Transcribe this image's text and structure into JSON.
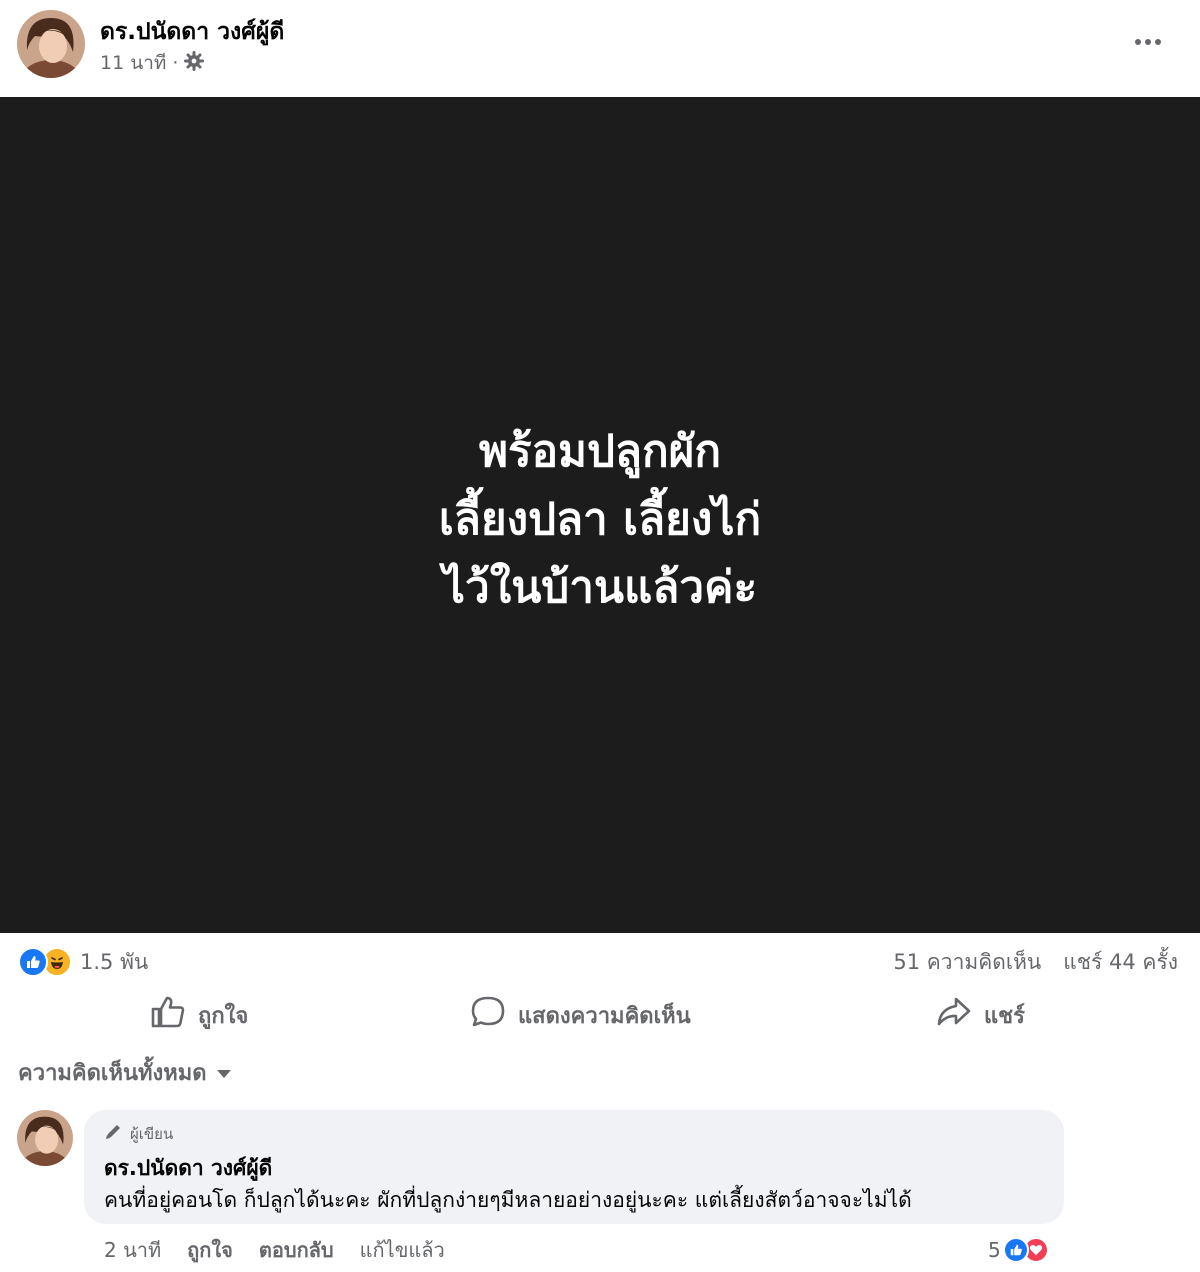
{
  "post": {
    "author": "ดร.ปนัดดา วงศ์ผู้ดี",
    "time": "11 นาที",
    "separator": "·",
    "privacy_icon": "gear-icon",
    "media_text": [
      "พร้อมปลูกผัก",
      "เลี้ยงปลา เลี้ยงไก่",
      "ไว้ในบ้านแล้วค่ะ"
    ]
  },
  "stats": {
    "reactions_count": "1.5 พัน",
    "reaction_icons": [
      "like-icon",
      "haha-icon"
    ],
    "comments": "51 ความคิดเห็น",
    "shares": "แชร์ 44 ครั้ง"
  },
  "actions": {
    "like": "ถูกใจ",
    "comment": "แสดงความคิดเห็น",
    "share": "แชร์"
  },
  "comments_section": {
    "filter": "ความคิดเห็นทั้งหมด"
  },
  "comment": {
    "badge": "ผู้เขียน",
    "author": "ดร.ปนัดดา วงศ์ผู้ดี",
    "text": "คนที่อยู่คอนโด ก็ปลูกได้นะคะ ผักที่ปลูกง่ายๆมีหลายอย่างอยู่นะคะ แต่เลี้ยงสัตว์อาจจะไม่ได้",
    "time": "2 นาที",
    "like": "ถูกใจ",
    "reply": "ตอบกลับ",
    "edited": "แก้ไขแล้ว",
    "reaction_count": "5",
    "reaction_icons": [
      "like-icon",
      "love-icon"
    ]
  },
  "colors": {
    "media_background": "#1c1c1d",
    "like_blue": "#1877f2",
    "love_red": "#f33e58",
    "haha_yellow": "#f7b125",
    "secondary_text": "#65676b",
    "bubble_background": "#f0f2f5"
  }
}
